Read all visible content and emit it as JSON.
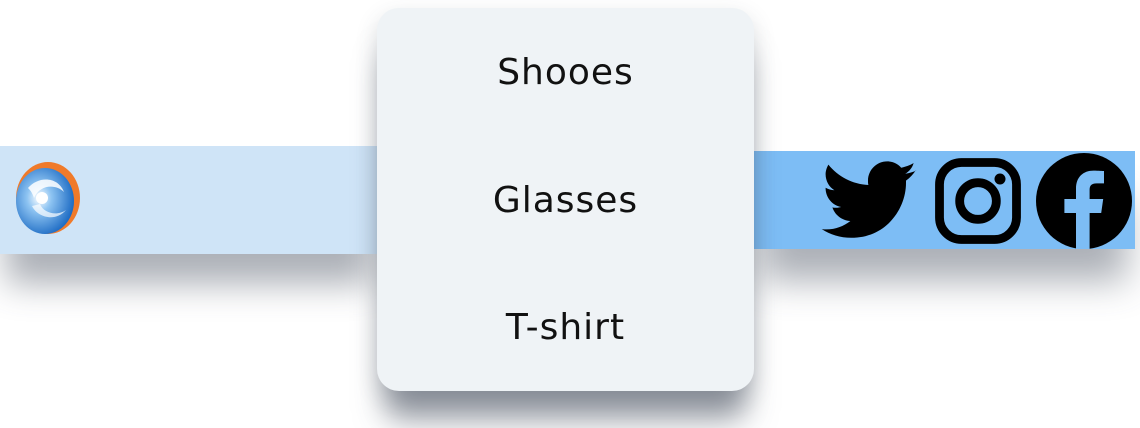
{
  "menu": {
    "items": [
      {
        "label": "Shooes"
      },
      {
        "label": "Glasses"
      },
      {
        "label": "T-shirt"
      }
    ]
  },
  "header": {
    "logo_icon": "brand-swirl-logo",
    "social": [
      {
        "icon": "twitter-icon"
      },
      {
        "icon": "instagram-icon"
      },
      {
        "icon": "facebook-icon"
      }
    ]
  },
  "colors": {
    "left_bar": "#cfe4f7",
    "right_bar": "#7dbdf5",
    "menu_bg": "#eff3f6",
    "logo_orange": "#f07a2a",
    "logo_blue": "#2a7fd4"
  }
}
